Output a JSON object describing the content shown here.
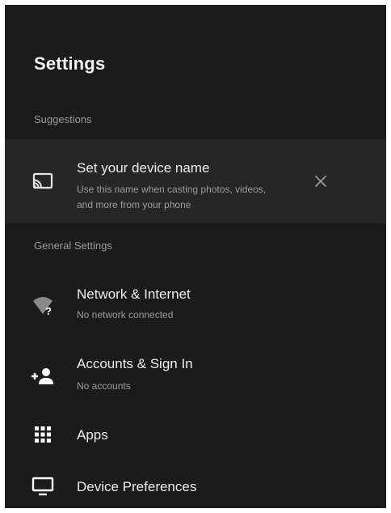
{
  "header": {
    "title": "Settings"
  },
  "suggestions": {
    "header": "Suggestions",
    "items": [
      {
        "title": "Set your device name",
        "subtitle_line1": "Use this name when casting photos, videos,",
        "subtitle_line2": "and more from your phone",
        "icon": "cast-icon",
        "dismiss_icon": "close-icon"
      }
    ]
  },
  "general": {
    "header": "General Settings",
    "items": [
      {
        "title": "Network & Internet",
        "subtitle": "No network connected",
        "icon": "wifi-unknown-icon"
      },
      {
        "title": "Accounts & Sign In",
        "subtitle": "No accounts",
        "icon": "add-person-icon"
      },
      {
        "title": "Apps",
        "icon": "apps-grid-icon"
      },
      {
        "title": "Device Preferences",
        "icon": "tv-icon"
      }
    ]
  },
  "colors": {
    "background": "#1b1b1b",
    "card": "#262626",
    "text_primary": "#ededed",
    "text_secondary": "#9c9c9c"
  }
}
